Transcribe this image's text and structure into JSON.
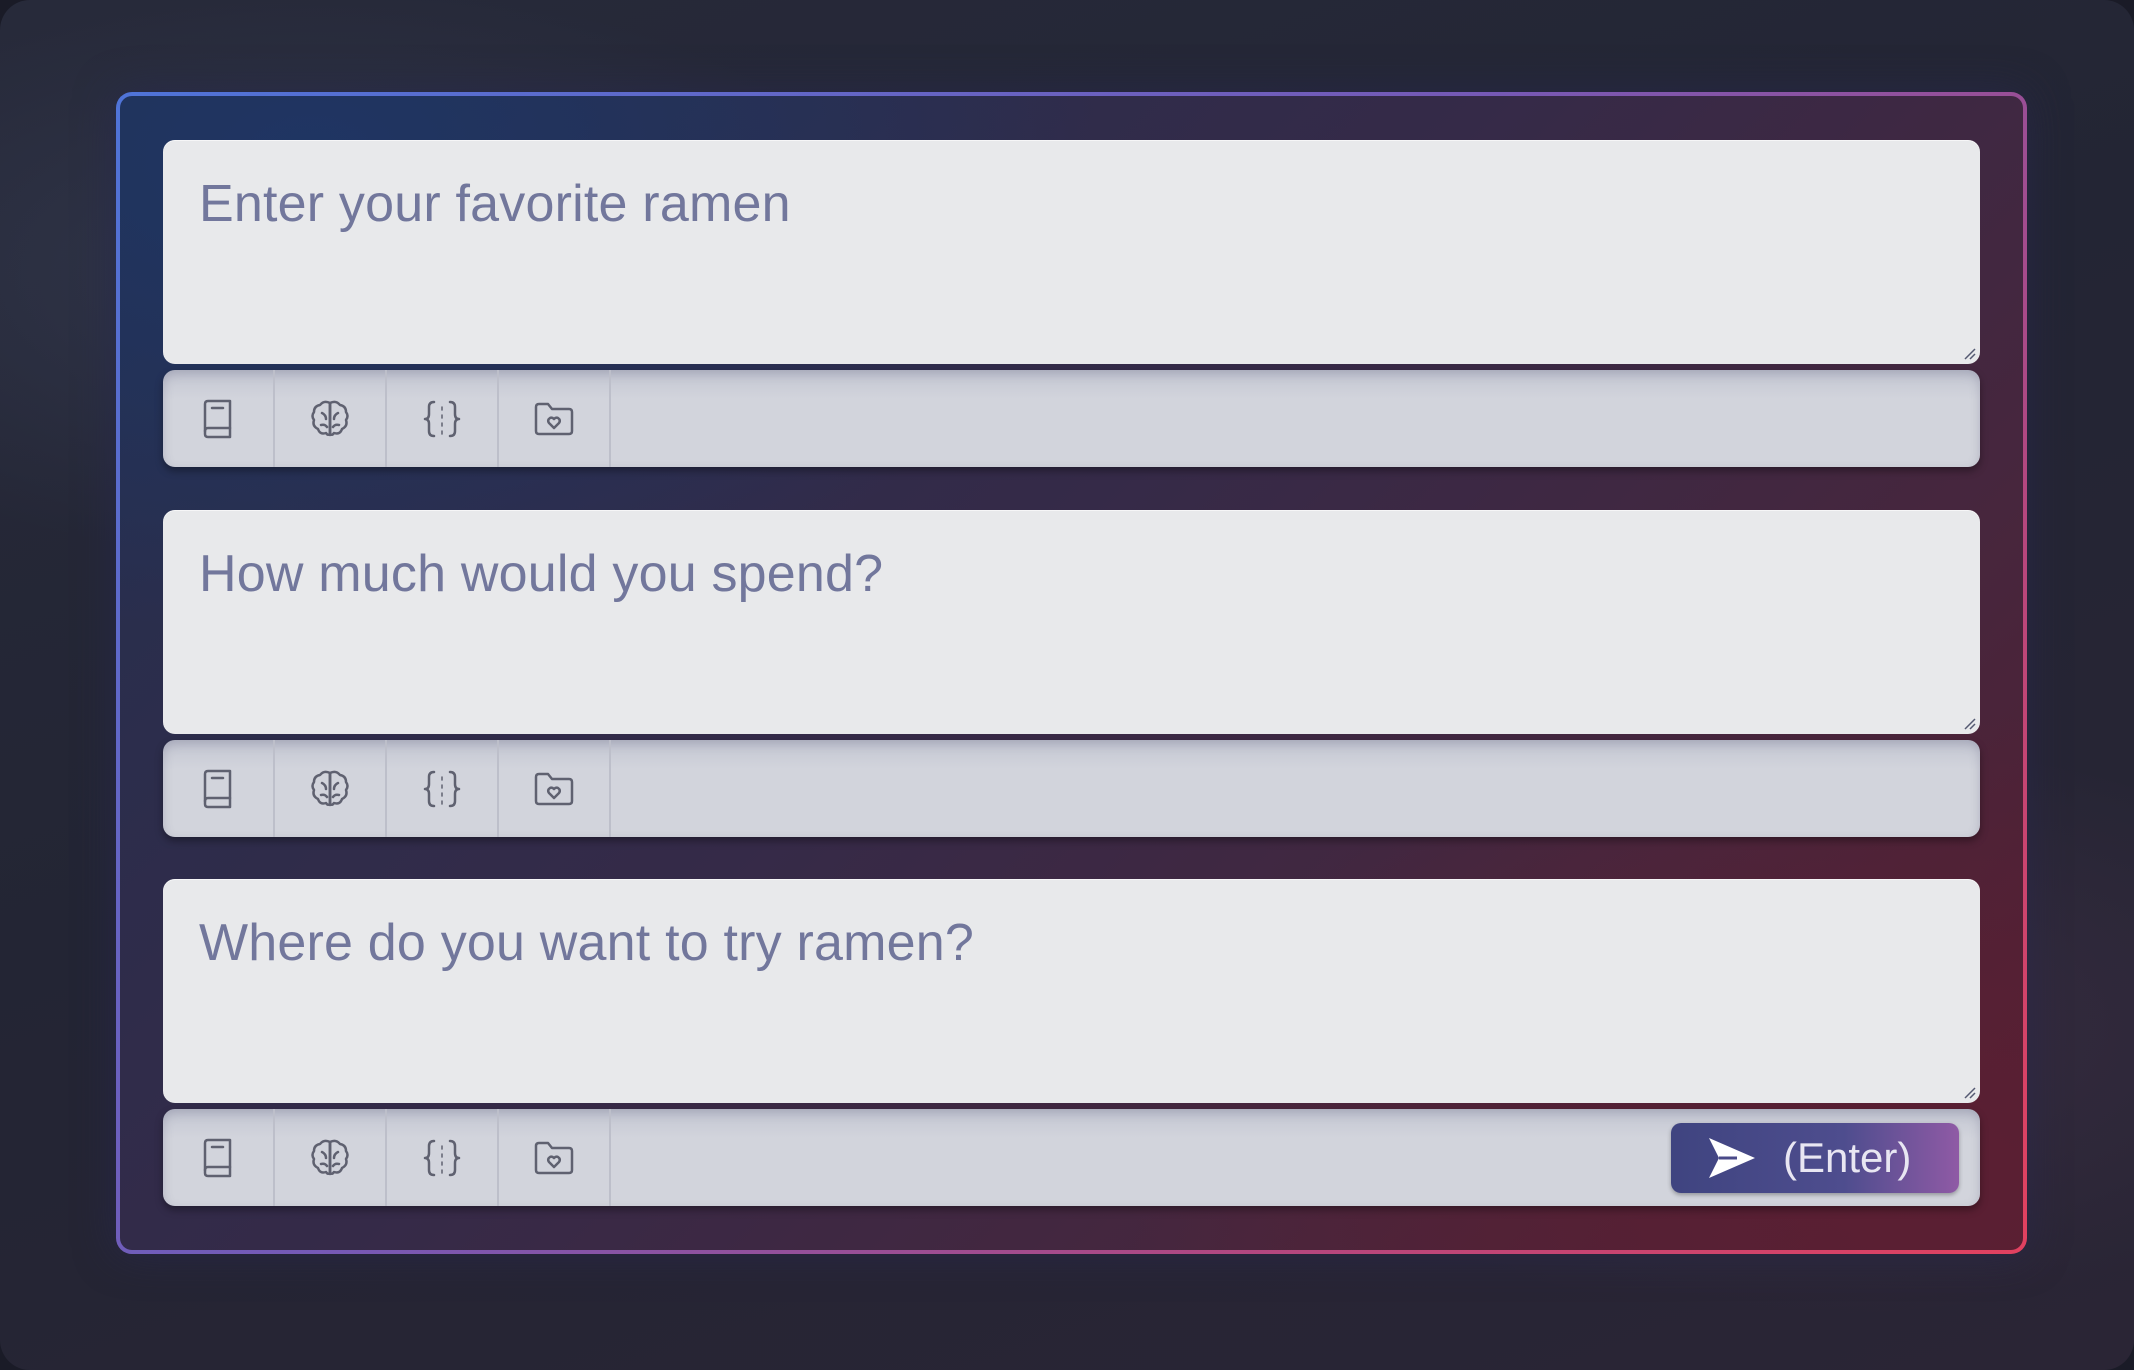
{
  "form": {
    "fields": [
      {
        "placeholder": "Enter your favorite ramen"
      },
      {
        "placeholder": "How much would you spend?"
      },
      {
        "placeholder": "Where do you want to try ramen?"
      }
    ],
    "toolbar_icons": [
      "book-icon",
      "brain-icon",
      "code-braces-icon",
      "folder-heart-icon"
    ],
    "send_button": {
      "icon": "send-icon",
      "label": "(Enter)"
    }
  },
  "colors": {
    "frame_gradient_start": "#4f74d8",
    "frame_gradient_end": "#e2415f",
    "textbox_bg": "#e8e9eb",
    "placeholder_text": "#72779c",
    "toolbar_bg": "#d2d4dc",
    "icon_stroke": "#5f6170",
    "send_button_start": "#3f4480",
    "send_button_end": "#8f5aa5"
  }
}
